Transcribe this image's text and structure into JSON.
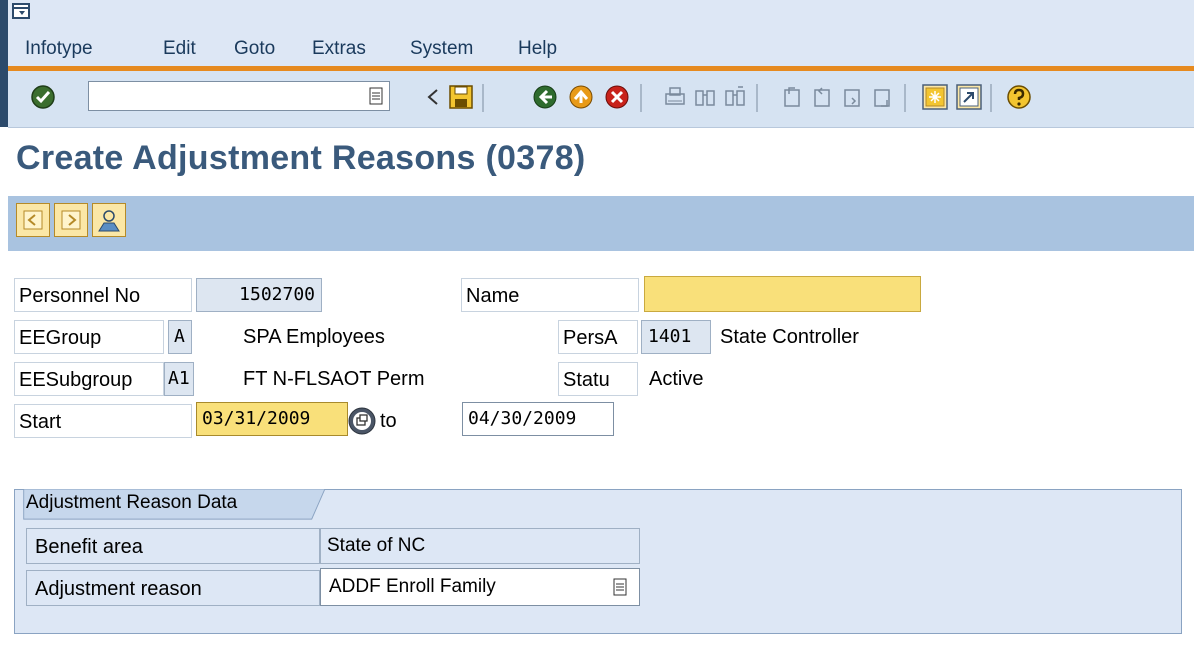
{
  "menu": {
    "items": [
      {
        "label": "Infotype"
      },
      {
        "label": "Edit"
      },
      {
        "label": "Goto"
      },
      {
        "label": "Extras"
      },
      {
        "label": "System"
      },
      {
        "label": "Help"
      }
    ]
  },
  "toolbar": {
    "command_field_value": "",
    "icons": [
      "enter-icon",
      "command-dropdown-icon",
      "collapse-icon",
      "save-icon",
      "back-icon",
      "exit-icon",
      "cancel-icon",
      "print-icon",
      "find-icon",
      "find-next-icon",
      "first-page-icon",
      "previous-page-icon",
      "next-page-icon",
      "last-page-icon",
      "create-session-icon",
      "shortcut-icon",
      "help-icon"
    ]
  },
  "page": {
    "title": "Create Adjustment Reasons (0378)"
  },
  "app_toolbar": {
    "icons": [
      "previous-record-icon",
      "next-record-icon",
      "personal-data-icon"
    ]
  },
  "header": {
    "personnel_no_label": "Personnel No",
    "personnel_no": "1502700",
    "name_label": "Name",
    "name_value": "",
    "eegroup_label": "EEGroup",
    "eegroup_code": "A",
    "eegroup_text": "SPA Employees",
    "persa_label": "PersA",
    "persa_code": "1401",
    "persa_text": "State Controller",
    "eesubgroup_label": "EESubgroup",
    "eesubgroup_code": "A1",
    "eesubgroup_text": "FT N-FLSAOT Perm",
    "status_label": "Statu",
    "status_text": "Active",
    "start_label": "Start",
    "start_date": "03/31/2009",
    "to_label": "to",
    "end_date": "04/30/2009"
  },
  "group": {
    "title": "Adjustment Reason Data",
    "benefit_area_label": "Benefit area",
    "benefit_area_value": "State of NC",
    "adjustment_reason_label": "Adjustment reason",
    "adjustment_reason_value": "ADDF Enroll Family"
  },
  "colors": {
    "title": "#3a5a7c",
    "accent_line": "#e68a1f",
    "highlight_field": "#f9e07a",
    "app_toolbar": "#a9c3e0"
  }
}
